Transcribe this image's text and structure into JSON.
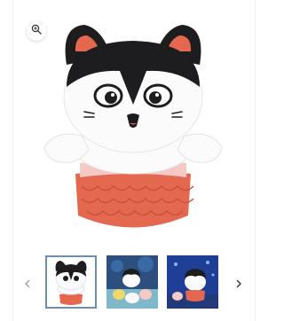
{
  "product": {
    "image": "plush-toy-cat-mermaid"
  },
  "gallery": {
    "zoom_icon": "zoom-in-icon",
    "prev_icon": "chevron-left-icon",
    "next_icon": "chevron-right-icon",
    "selected_index": 0,
    "thumbnails": [
      {
        "name": "thumbnail-plush-front",
        "selected": true
      },
      {
        "name": "thumbnail-plush-scene",
        "selected": false
      },
      {
        "name": "thumbnail-plush-fireworks",
        "selected": false
      }
    ]
  },
  "colors": {
    "accent_border": "#6b8fb3",
    "plush_white": "#fbfbfb",
    "plush_black": "#1d1d1f",
    "plush_orange": "#e4684f"
  }
}
